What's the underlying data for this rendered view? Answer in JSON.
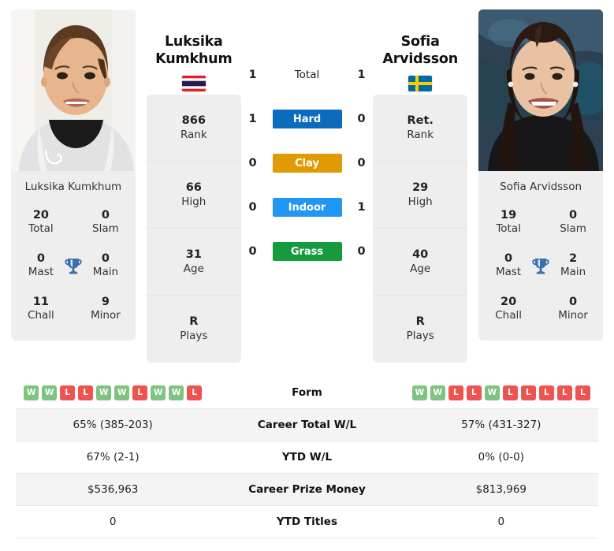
{
  "players": {
    "left": {
      "name_line1": "Luksika",
      "name_line2": "Kumkhum",
      "full_name": "Luksika Kumkhum",
      "flag": "thailand-flag",
      "info": [
        {
          "value": "866",
          "label": "Rank"
        },
        {
          "value": "66",
          "label": "High"
        },
        {
          "value": "31",
          "label": "Age"
        },
        {
          "value": "R",
          "label": "Plays"
        }
      ],
      "titles": [
        {
          "value": "20",
          "label": "Total"
        },
        {
          "value": "0",
          "label": "Slam"
        },
        {
          "value": "0",
          "label": "Mast"
        },
        {
          "value": "0",
          "label": "Main"
        },
        {
          "value": "11",
          "label": "Chall"
        },
        {
          "value": "9",
          "label": "Minor"
        }
      ],
      "form": [
        "W",
        "W",
        "L",
        "L",
        "W",
        "W",
        "L",
        "W",
        "W",
        "L"
      ],
      "career_total_wl": "65% (385-203)",
      "ytd_wl": "67% (2-1)",
      "career_prize_money": "$536,963",
      "ytd_titles": "0"
    },
    "right": {
      "name_line1": "Sofia",
      "name_line2": "Arvidsson",
      "full_name": "Sofia Arvidsson",
      "flag": "sweden-flag",
      "info": [
        {
          "value": "Ret.",
          "label": "Rank"
        },
        {
          "value": "29",
          "label": "High"
        },
        {
          "value": "40",
          "label": "Age"
        },
        {
          "value": "R",
          "label": "Plays"
        }
      ],
      "titles": [
        {
          "value": "19",
          "label": "Total"
        },
        {
          "value": "0",
          "label": "Slam"
        },
        {
          "value": "0",
          "label": "Mast"
        },
        {
          "value": "2",
          "label": "Main"
        },
        {
          "value": "20",
          "label": "Chall"
        },
        {
          "value": "0",
          "label": "Minor"
        }
      ],
      "form": [
        "W",
        "W",
        "L",
        "L",
        "W",
        "L",
        "L",
        "L",
        "L",
        "L"
      ],
      "career_total_wl": "57% (431-327)",
      "ytd_wl": "0% (0-0)",
      "career_prize_money": "$813,969",
      "ytd_titles": "0"
    }
  },
  "surfaces": [
    {
      "label": "Total",
      "left": "1",
      "right": "1",
      "color": "transparent",
      "is_total": true
    },
    {
      "label": "Hard",
      "left": "1",
      "right": "0",
      "color": "#0b6cbd",
      "is_total": false
    },
    {
      "label": "Clay",
      "left": "0",
      "right": "0",
      "color": "#e09b04",
      "is_total": false
    },
    {
      "label": "Indoor",
      "left": "0",
      "right": "1",
      "color": "#2196f3",
      "is_total": false
    },
    {
      "label": "Grass",
      "left": "0",
      "right": "0",
      "color": "#159a3d",
      "is_total": false
    }
  ],
  "table_rows": [
    {
      "label": "Form",
      "type": "form",
      "left": "",
      "right": ""
    },
    {
      "label": "Career Total W/L",
      "type": "text",
      "left": "65% (385-203)",
      "right": "57% (431-327)"
    },
    {
      "label": "YTD W/L",
      "type": "text",
      "left": "67% (2-1)",
      "right": "0% (0-0)"
    },
    {
      "label": "Career Prize Money",
      "type": "text",
      "left": "$536,963",
      "right": "$813,969"
    },
    {
      "label": "YTD Titles",
      "type": "text",
      "left": "0",
      "right": "0"
    }
  ],
  "colors": {
    "hard": "#0b6cbd",
    "clay": "#e09b04",
    "indoor": "#2196f3",
    "grass": "#159a3d",
    "win": "#7cc47f",
    "loss": "#ef5350",
    "trophy": "#3b6fb0",
    "card_bg": "#eeeeee"
  }
}
